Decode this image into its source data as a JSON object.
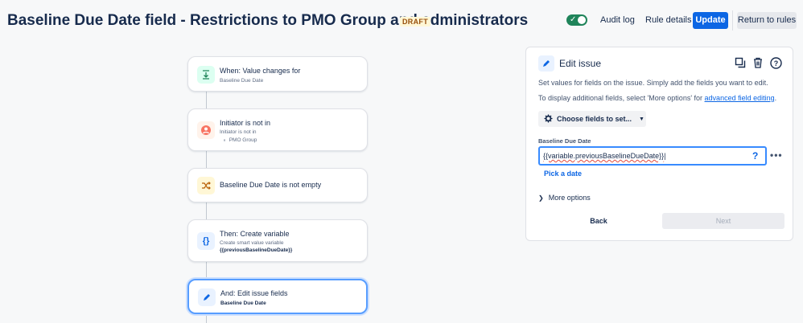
{
  "header": {
    "title": "Baseline Due Date field - Restrictions to PMO Group and administrators",
    "status_badge": "DRAFT",
    "toggle_enabled": true,
    "audit_log": "Audit log",
    "rule_details": "Rule details",
    "update": "Update",
    "return_to_rules": "Return to rules"
  },
  "flow": {
    "steps": [
      {
        "title": "When: Value changes for",
        "sub": "Baseline Due Date",
        "icon": "trigger-icon",
        "color": "#1f845a",
        "bg": "#dcfff1"
      },
      {
        "title": "Initiator is not in",
        "sub": "Initiator is not in",
        "sub2": "PMO Group",
        "icon": "user-condition-icon",
        "color": "#e2483d",
        "bg": "#fff3eb"
      },
      {
        "title": "Baseline Due Date is not empty",
        "icon": "shuffle-icon",
        "color": "#b65c02",
        "bg": "#fff7d6"
      },
      {
        "title": "Then: Create variable",
        "sub": "Create smart value variable",
        "sub2": "{{previousBaselineDueDate}}",
        "icon": "braces-icon",
        "color": "#0c66e4",
        "bg": "#e9f2ff"
      },
      {
        "title": "And: Edit issue fields",
        "sub": "Baseline Due Date",
        "icon": "pencil-icon",
        "color": "#0c66e4",
        "bg": "#e9f2ff"
      }
    ]
  },
  "panel": {
    "title": "Edit issue",
    "desc1": "Set values for fields on the issue. Simply add the fields you want to edit.",
    "desc2_prefix": "To display additional fields, select 'More options' for ",
    "desc2_link": "advanced field editing",
    "desc2_suffix": ".",
    "choose_fields": "Choose fields to set...",
    "field_label": "Baseline Due Date",
    "field_value": "{{variable.previousBaselineDueDate}}",
    "field_help": "?",
    "pick_date": "Pick a date",
    "more_options": "More options",
    "back": "Back",
    "next": "Next"
  }
}
